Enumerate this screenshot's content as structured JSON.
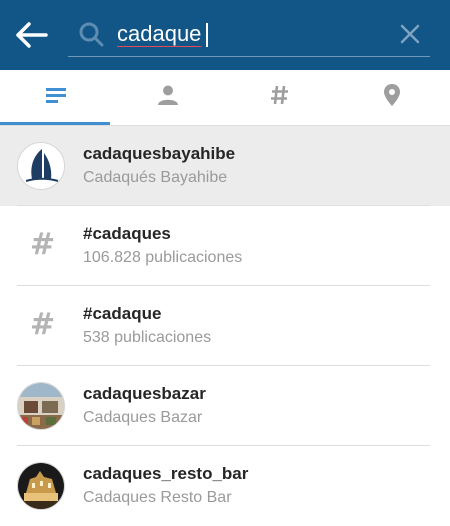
{
  "search": {
    "value": "cadaque",
    "accent_color": "#125688"
  },
  "tabs": [
    {
      "icon": "list-icon",
      "selected": true
    },
    {
      "icon": "person-icon",
      "selected": false
    },
    {
      "icon": "hashtag-icon",
      "selected": false
    },
    {
      "icon": "location-pin-icon",
      "selected": false
    }
  ],
  "results": [
    {
      "type": "user",
      "title": "cadaquesbayahibe",
      "subtitle": "Cadaqués Bayahibe",
      "icon": "sailboat-logo"
    },
    {
      "type": "hashtag",
      "title": "#cadaques",
      "subtitle": "106.828 publicaciones",
      "icon": "#"
    },
    {
      "type": "hashtag",
      "title": "#cadaque",
      "subtitle": "538 publicaciones",
      "icon": "#"
    },
    {
      "type": "user",
      "title": "cadaquesbazar",
      "subtitle": "Cadaques Bazar",
      "icon": "storefront-photo"
    },
    {
      "type": "user",
      "title": "cadaques_resto_bar",
      "subtitle": "Cadaques Resto Bar",
      "icon": "night-building-photo"
    }
  ]
}
